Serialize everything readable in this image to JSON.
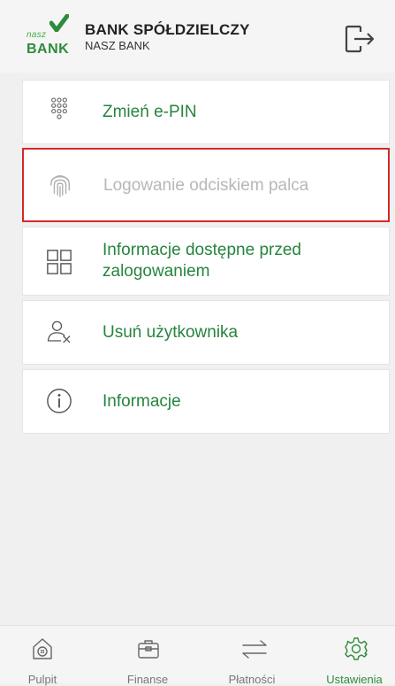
{
  "header": {
    "logo_small": "nasz",
    "logo_big": "BANK",
    "bank_name": "BANK SPÓŁDZIELCZY",
    "bank_sub": "NASZ BANK",
    "logout_icon": "logout-icon"
  },
  "menu": {
    "items": [
      {
        "label": "Zmień e-PIN",
        "icon": "keypad-icon",
        "enabled": true
      },
      {
        "label": "Logowanie odciskiem palca",
        "icon": "fingerprint-icon",
        "enabled": false,
        "highlighted": true
      },
      {
        "label_line1": "Informacje dostępne przed",
        "label_line2": "zalogowaniem",
        "icon": "grid-icon",
        "enabled": true
      },
      {
        "label": "Usuń użytkownika",
        "icon": "remove-user-icon",
        "enabled": true
      },
      {
        "label": "Informacje",
        "icon": "info-icon",
        "enabled": true
      }
    ]
  },
  "bottom_nav": {
    "items": [
      {
        "label": "Pulpit",
        "icon": "home-icon",
        "active": false
      },
      {
        "label": "Finanse",
        "icon": "wallet-icon",
        "active": false
      },
      {
        "label": "Płatności",
        "icon": "transfer-arrows-icon",
        "active": false
      },
      {
        "label": "Ustawienia",
        "icon": "gear-icon",
        "active": true
      }
    ]
  },
  "colors": {
    "accent": "#26843e",
    "disabled": "#b7b7b7",
    "highlight_border": "#d62828",
    "background": "#f0f0f0"
  }
}
